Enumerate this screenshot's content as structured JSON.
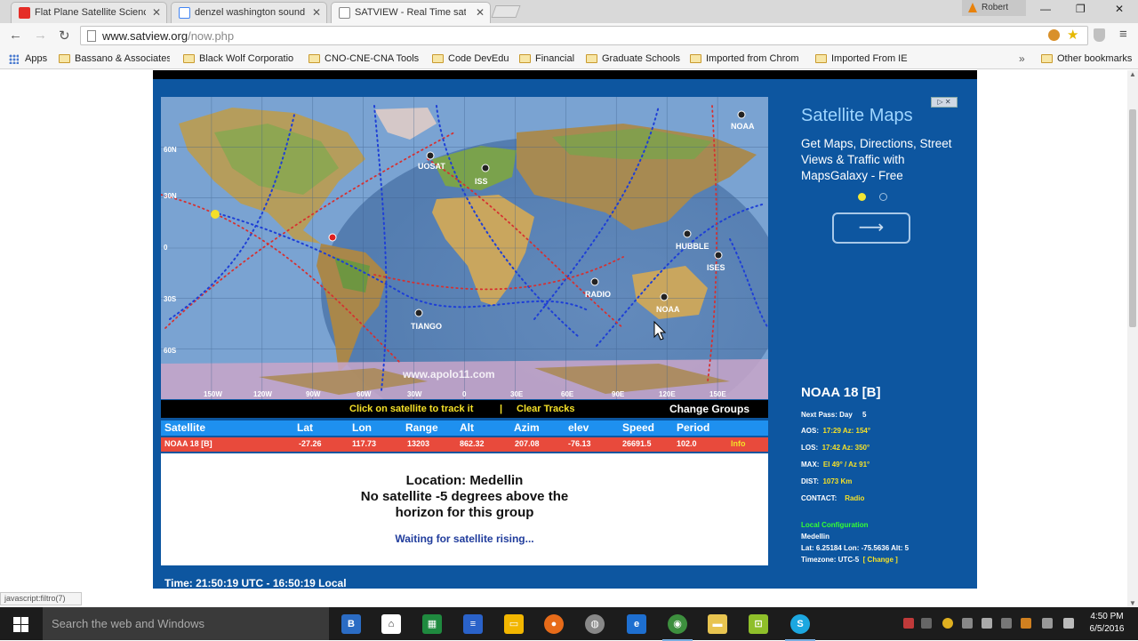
{
  "browser": {
    "tabs": [
      {
        "title": "Flat Plane Satellite Scienc",
        "favicon": "youtube-icon",
        "active": false
      },
      {
        "title": "denzel washington sound",
        "favicon": "google-icon",
        "active": false
      },
      {
        "title": "SATVIEW - Real Time sat",
        "favicon": "page-icon",
        "active": true
      }
    ],
    "profile_name": "Robert",
    "url_host": "www.satview.org",
    "url_path": "/now.php",
    "bookmarks": [
      "Apps",
      "Bassano & Associates",
      "Black Wolf Corporatio",
      "CNO-CNE-CNA Tools",
      "Code DevEdu",
      "Financial",
      "Graduate Schools",
      "Imported from Chrom",
      "Imported From IE"
    ],
    "other_bookmarks": "Other bookmarks",
    "status_bubble": "javascript:filtro(7)"
  },
  "map": {
    "lat_labels": [
      "60N",
      "30N",
      "0",
      "30S",
      "60S"
    ],
    "lon_labels": [
      "150W",
      "120W",
      "90W",
      "60W",
      "30W",
      "0",
      "30E",
      "60E",
      "90E",
      "120E",
      "150E"
    ],
    "watermark": "www.apolo11.com",
    "satellites": [
      "NOAA",
      "UOSAT",
      "ISS",
      "HUBBLE",
      "ISES",
      "RADIO",
      "NOAA",
      "TIANGO"
    ]
  },
  "tracker": {
    "click_hint": "Click on satellite to track it",
    "separator": "|",
    "clear_tracks": "Clear Tracks",
    "change_groups": "Change Groups",
    "columns": [
      "Satellite",
      "Lat",
      "Lon",
      "Range",
      "Alt",
      "Azim",
      "elev",
      "Speed",
      "Period"
    ],
    "row": [
      "NOAA 18 [B]",
      "-27.26",
      "117.73",
      "13203",
      "862.32",
      "207.08",
      "-76.13",
      "26691.5",
      "102.0",
      "Info"
    ]
  },
  "status": {
    "location_line": "Location: Medellin",
    "line2": "No satellite -5 degrees above the",
    "line3": "horizon for this group",
    "waiting": "Waiting for satellite rising..."
  },
  "timeline": "Time:  21:50:19 UTC - 16:50:19 Local",
  "ad": {
    "title": "Satellite Maps",
    "description": "Get Maps, Directions, Street Views & Traffic with MapsGalaxy - Free",
    "ad_badge": "▷ ✕",
    "arrow": "⟶"
  },
  "satellite_info": {
    "name": "NOAA 18 [B]",
    "next_pass_label": "Next Pass: Day",
    "next_pass_value": "5",
    "aos_label": "AOS:",
    "aos_value": "17:29  Az: 154°",
    "los_label": "LOS:",
    "los_value": "17:42  Az: 350°",
    "max_label": "MAX:",
    "max_value": "El 49° / Az 91°",
    "dist_label": "DIST:",
    "dist_value": "1073 Km",
    "contact_label": "CONTACT:",
    "contact_value": "Radio",
    "local_config_label": "Local Configuration",
    "local_city": "Medellin",
    "local_coords": "Lat: 6.25184  Lon: -75.5636  Alt: 5",
    "timezone_label": "Timezone:",
    "timezone_value": "UTC-5",
    "change_label": "[ Change ]"
  },
  "taskbar": {
    "search_placeholder": "Search the web and Windows",
    "time": "4:50 PM",
    "date": "6/5/2016"
  }
}
